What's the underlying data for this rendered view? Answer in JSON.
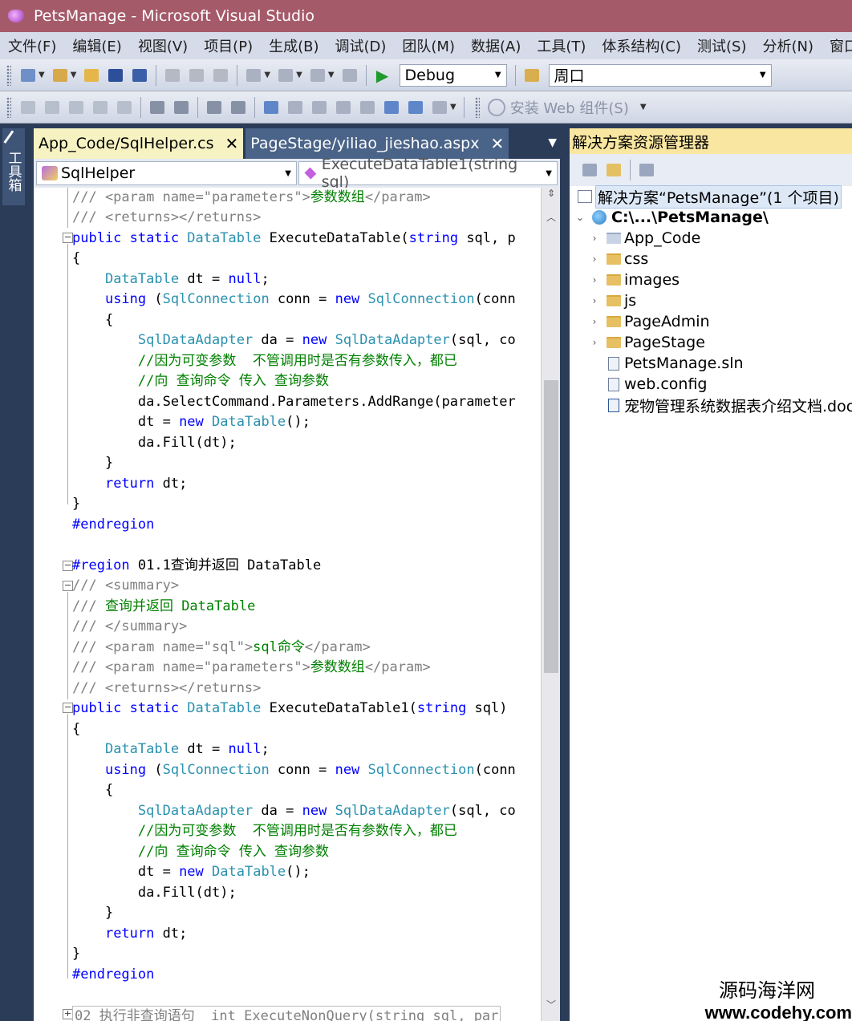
{
  "window": {
    "title": "PetsManage - Microsoft Visual Studio"
  },
  "menu": [
    "文件(F)",
    "编辑(E)",
    "视图(V)",
    "项目(P)",
    "生成(B)",
    "调试(D)",
    "团队(M)",
    "数据(A)",
    "工具(T)",
    "体系结构(C)",
    "测试(S)",
    "分析(N)",
    "窗口(W"
  ],
  "toolbar": {
    "config": "Debug",
    "find_combo": "周口",
    "install_web": "安装 Web 组件(S)"
  },
  "toolbox": {
    "label": "工具箱"
  },
  "tabs": [
    {
      "label": "App_Code/SqlHelper.cs",
      "active": true
    },
    {
      "label": "PageStage/yiliao_jieshao.aspx",
      "active": false
    }
  ],
  "nav": {
    "class": "SqlHelper",
    "member": "ExecuteDataTable1(string sql)"
  },
  "code": {
    "lines": [
      "/// <param name=\"parameters\">参数数组</param>",
      "/// <returns></returns>",
      "public static DataTable ExecuteDataTable(string sql, p",
      "{",
      "    DataTable dt = null;",
      "    using (SqlConnection conn = new SqlConnection(conn",
      "    {",
      "        SqlDataAdapter da = new SqlDataAdapter(sql, co",
      "        //因为可变参数  不管调用时是否有参数传入，都已",
      "        //向 查询命令 传入 查询参数",
      "        da.SelectCommand.Parameters.AddRange(parameter",
      "        dt = new DataTable();",
      "        da.Fill(dt);",
      "    }",
      "    return dt;",
      "}",
      "#endregion",
      "",
      "#region 01.1查询并返回 DataTable",
      "/// <summary>",
      "/// 查询并返回 DataTable",
      "/// </summary>",
      "/// <param name=\"sql\">sql命令</param>",
      "/// <param name=\"parameters\">参数数组</param>",
      "/// <returns></returns>",
      "public static DataTable ExecuteDataTable1(string sql)",
      "{",
      "    DataTable dt = null;",
      "    using (SqlConnection conn = new SqlConnection(conn",
      "    {",
      "        SqlDataAdapter da = new SqlDataAdapter(sql, co",
      "        //因为可变参数  不管调用时是否有参数传入，都已",
      "        //向 查询命令 传入 查询参数",
      "        dt = new DataTable();",
      "        da.Fill(dt);",
      "    }",
      "    return dt;",
      "}",
      "#endregion",
      "",
      "02 执行非查询语句  int ExecuteNonQuery(string sql, par"
    ]
  },
  "solution_explorer": {
    "title": "解决方案资源管理器",
    "items": [
      {
        "label": "解决方案“PetsManage”(1 个项目)"
      },
      {
        "label": "C:\\...\\PetsManage\\"
      },
      {
        "label": "App_Code"
      },
      {
        "label": "css"
      },
      {
        "label": "images"
      },
      {
        "label": "js"
      },
      {
        "label": "PageAdmin"
      },
      {
        "label": "PageStage"
      },
      {
        "label": "PetsManage.sln"
      },
      {
        "label": "web.config"
      },
      {
        "label": "宠物管理系统数据表介绍文档.docx"
      }
    ]
  },
  "watermark": {
    "line1": "源码海洋网",
    "line2": "www.codehy.com"
  }
}
